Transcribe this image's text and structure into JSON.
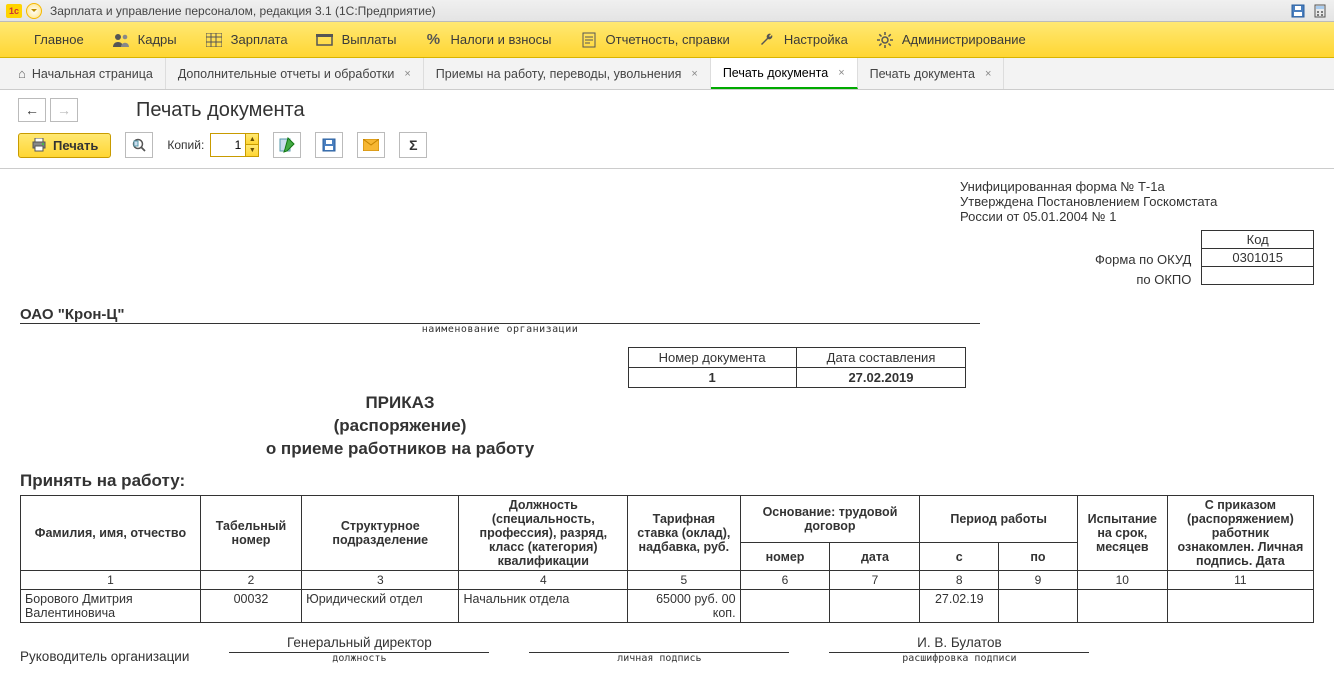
{
  "window": {
    "title": "Зарплата и управление персоналом, редакция 3.1  (1С:Предприятие)"
  },
  "main_menu": {
    "items": [
      {
        "label": "Главное"
      },
      {
        "label": "Кадры"
      },
      {
        "label": "Зарплата"
      },
      {
        "label": "Выплаты"
      },
      {
        "label": "Налоги и взносы"
      },
      {
        "label": "Отчетность, справки"
      },
      {
        "label": "Настройка"
      },
      {
        "label": "Администрирование"
      }
    ]
  },
  "tabs": [
    {
      "label": "Начальная страница",
      "closable": false,
      "active": false,
      "home": true
    },
    {
      "label": "Дополнительные отчеты и обработки",
      "closable": true,
      "active": false
    },
    {
      "label": "Приемы на работу, переводы, увольнения",
      "closable": true,
      "active": false
    },
    {
      "label": "Печать документа",
      "closable": true,
      "active": true
    },
    {
      "label": "Печать документа",
      "closable": true,
      "active": false
    }
  ],
  "page": {
    "title": "Печать документа"
  },
  "toolbar": {
    "print": "Печать",
    "copies_label": "Копий:",
    "copies_value": "1"
  },
  "doc": {
    "form_note_line1": "Унифицированная форма № Т-1а",
    "form_note_line2": "Утверждена Постановлением Госкомстата",
    "form_note_line3": "России от 05.01.2004 № 1",
    "okud_header": "Код",
    "okud_label": "Форма по ОКУД",
    "okud_value": "0301015",
    "okpo_label": "по ОКПО",
    "org_name": "ОАО \"Крон-Ц\"",
    "org_caption": "наименование организации",
    "docnum_h1": "Номер документа",
    "docnum_h2": "Дата составления",
    "docnum_v1": "1",
    "docnum_v2": "27.02.2019",
    "title_line1": "ПРИКАЗ",
    "title_line2": "(распоряжение)",
    "title_line3": "о приеме работников на работу",
    "accept": "Принять на работу:",
    "headers": {
      "fio": "Фамилия, имя, отчество",
      "tabnum": "Табельный номер",
      "dept": "Структурное подразделение",
      "position": "Должность (специальность, профессия), разряд, класс (категория) квалификации",
      "rate": "Тарифная ставка (оклад), надбавка, руб.",
      "contract": "Основание: трудовой договор",
      "contract_num": "номер",
      "contract_date": "дата",
      "period": "Период работы",
      "period_from": "с",
      "period_to": "по",
      "probation": "Испыта­ние на срок, месяцев",
      "ack": "С приказом (распоряже­нием) работник ознакомлен. Личная подпись. Дата"
    },
    "colnums": [
      "1",
      "2",
      "3",
      "4",
      "5",
      "6",
      "7",
      "8",
      "9",
      "10",
      "11"
    ],
    "row": {
      "fio": "Борового Дмитрия Валентиновича",
      "tabnum": "00032",
      "dept": "Юридический отдел",
      "position": "Начальник отдела",
      "rate": "65000 руб. 00 коп.",
      "contract_num": "",
      "contract_date": "",
      "from": "27.02.19",
      "to": "",
      "probation": "",
      "ack": ""
    },
    "sign": {
      "head_label": "Руководитель организации",
      "position_value": "Генеральный директор",
      "position_cap": "должность",
      "sign_cap": "личная подпись",
      "name_value": "И. В. Булатов",
      "name_cap": "расшифровка  подписи"
    }
  }
}
